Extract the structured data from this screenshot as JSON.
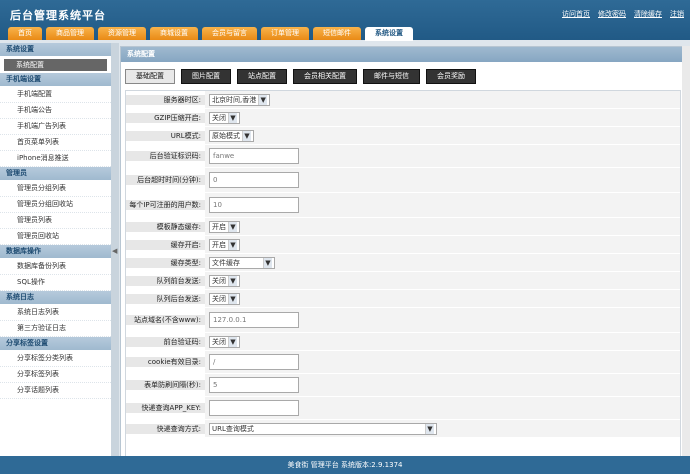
{
  "app": {
    "title": "后台管理系统平台"
  },
  "top_links": [
    "访问首页",
    "修改密码",
    "清除缓存",
    "注销"
  ],
  "tabs": [
    "首页",
    "商品管理",
    "资源管理",
    "商城设置",
    "会员与留言",
    "订单管理",
    "短信邮件",
    "系统设置"
  ],
  "sidebar": [
    {
      "head": "系统设置",
      "items": [
        "系统配置"
      ]
    },
    {
      "head": "手机端设置",
      "items": [
        "手机端配置",
        "手机端公告",
        "手机端广告列表",
        "首页菜单列表",
        "iPhone消息推送"
      ]
    },
    {
      "head": "管理员",
      "items": [
        "管理员分组列表",
        "管理员分组回收站",
        "管理员列表",
        "管理员回收站"
      ]
    },
    {
      "head": "数据库操作",
      "items": [
        "数据库备份列表",
        "SQL操作"
      ]
    },
    {
      "head": "系统日志",
      "items": [
        "系统日志列表",
        "第三方验证日志"
      ]
    },
    {
      "head": "分享标签设置",
      "items": [
        "分享标签分类列表",
        "分享标签列表",
        "分享话题列表"
      ]
    }
  ],
  "main": {
    "title": "系统配置",
    "subtabs": [
      "基础配置",
      "图片配置",
      "站点配置",
      "会员相关配置",
      "邮件与短信",
      "会员奖励"
    ]
  },
  "form": [
    {
      "label": "服务器时区:",
      "type": "select",
      "value": "北京时间,香港"
    },
    {
      "label": "GZIP压缩开启:",
      "type": "select",
      "value": "关闭"
    },
    {
      "label": "URL模式:",
      "type": "select",
      "value": "原始模式"
    },
    {
      "label": "后台验证标识码:",
      "type": "input",
      "value": "fanwe"
    },
    {
      "label": "后台超时时间(分钟):",
      "type": "input",
      "value": "0"
    },
    {
      "label": "每个IP可注册的用户数:",
      "type": "input",
      "value": "10"
    },
    {
      "label": "模板静态缓存:",
      "type": "select",
      "value": "开启"
    },
    {
      "label": "缓存开启:",
      "type": "select",
      "value": "开启"
    },
    {
      "label": "缓存类型:",
      "type": "select",
      "value": "文件缓存"
    },
    {
      "label": "队列前台发送:",
      "type": "select",
      "value": "关闭"
    },
    {
      "label": "队列后台发送:",
      "type": "select",
      "value": "关闭"
    },
    {
      "label": "站点域名(不含www):",
      "type": "input",
      "value": "127.0.0.1"
    },
    {
      "label": "前台验证码:",
      "type": "select",
      "value": "关闭"
    },
    {
      "label": "cookie有效目录:",
      "type": "input",
      "value": "/"
    },
    {
      "label": "表单防刷间隔(秒):",
      "type": "input",
      "value": "5"
    },
    {
      "label": "快递查询APP_KEY:",
      "type": "input",
      "value": ""
    },
    {
      "label": "快递查询方式:",
      "type": "select",
      "value": "URL查询模式"
    }
  ],
  "footer": {
    "text": "美食街 管理平台 系统版本:2.9.1374"
  }
}
